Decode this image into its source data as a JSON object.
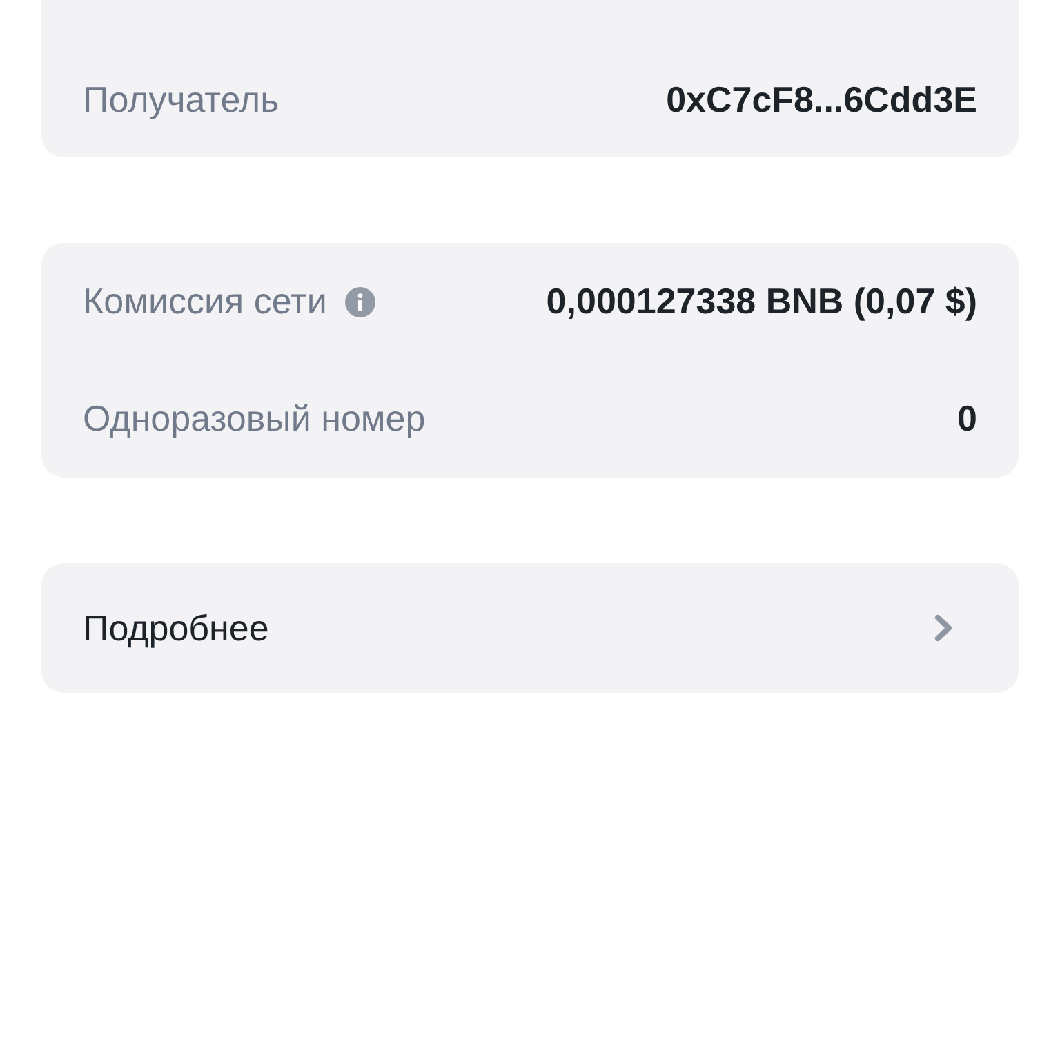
{
  "cards": [
    {
      "rows": [
        {
          "label": "Получатель",
          "info": false,
          "value": "0xC7cF8...6Cdd3E"
        }
      ]
    },
    {
      "rows": [
        {
          "label": "Комиссия сети",
          "info": true,
          "value": "0,000127338 BNB (0,07 $)"
        },
        {
          "label": "Одноразовый номер",
          "info": false,
          "value": "0"
        }
      ]
    }
  ],
  "details_link": {
    "label": "Подробнее"
  }
}
